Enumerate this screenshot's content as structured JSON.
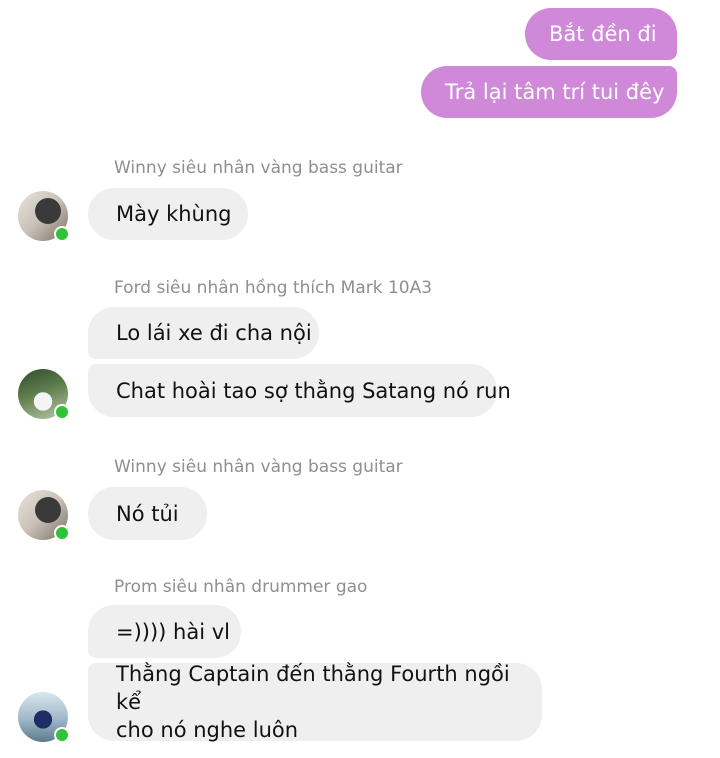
{
  "outgoing": [
    {
      "text": "Bắt đền đi"
    },
    {
      "text": "Trả lại tâm trí tui đêy"
    }
  ],
  "groups": [
    {
      "sender": "Winny siêu nhân vàng bass guitar",
      "messages": [
        "Mày khùng"
      ]
    },
    {
      "sender": "Ford siêu nhân hồng thích Mark 10A3",
      "messages": [
        "Lo lái xe đi cha nội",
        "Chat hoài tao sợ thằng Satang nó run"
      ]
    },
    {
      "sender": "Winny siêu nhân vàng bass guitar",
      "messages": [
        "Nó tủi"
      ]
    },
    {
      "sender": "Prom siêu nhân drummer gao",
      "messages": [
        "=)))) hài vl",
        "Thằng Captain đến thằng Fourth ngồi kể",
        "cho nó nghe luôn"
      ]
    }
  ],
  "colors": {
    "outgoing_bubble": "#d089d9",
    "incoming_bubble": "#efeff0",
    "sender_name": "#8e8e93",
    "online_dot": "#31c23a"
  }
}
